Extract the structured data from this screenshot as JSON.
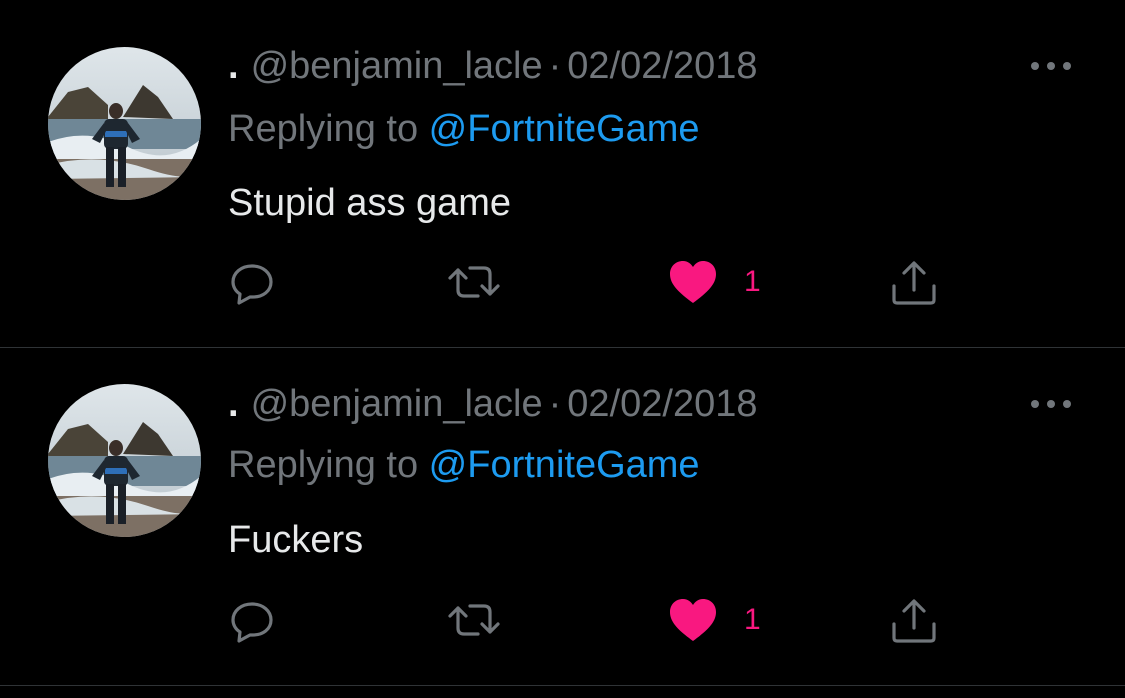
{
  "tweets": [
    {
      "display_name": ".",
      "handle": "@benjamin_lacle",
      "separator": "·",
      "date": "02/02/2018",
      "replying_prefix": "Replying to ",
      "replying_to": "@FortniteGame",
      "text": "Stupid ass game",
      "like_count": "1",
      "liked": true
    },
    {
      "display_name": ".",
      "handle": "@benjamin_lacle",
      "separator": "·",
      "date": "02/02/2018",
      "replying_prefix": "Replying to ",
      "replying_to": "@FortniteGame",
      "text": "Fuckers",
      "like_count": "1",
      "liked": true
    }
  ],
  "colors": {
    "background": "#000000",
    "text": "#e7e9ea",
    "muted": "#71767b",
    "link": "#1d9bf0",
    "like": "#f91880",
    "divider": "#2f3336"
  },
  "icons": [
    "reply-icon",
    "retweet-icon",
    "heart-icon",
    "share-icon",
    "more-icon"
  ]
}
